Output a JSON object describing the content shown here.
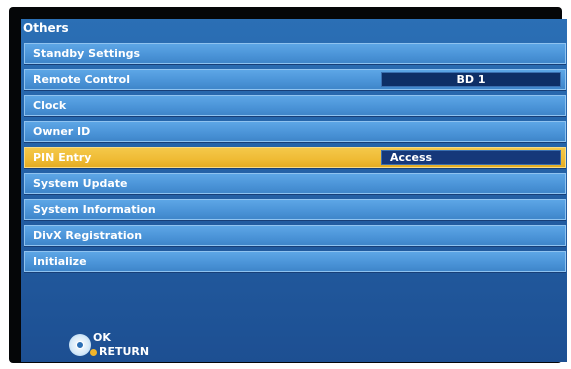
{
  "title": "Others",
  "menu": {
    "items": [
      {
        "label": "Standby Settings"
      },
      {
        "label": "Remote Control",
        "value": "BD 1"
      },
      {
        "label": "Clock"
      },
      {
        "label": "Owner ID"
      },
      {
        "label": "PIN Entry",
        "value": "Access",
        "selected": true
      },
      {
        "label": "System Update"
      },
      {
        "label": "System Information"
      },
      {
        "label": "DivX Registration"
      },
      {
        "label": "Initialize"
      }
    ]
  },
  "footer": {
    "ok_label": "OK",
    "return_label": "RETURN",
    "ok_icon": "dpad-select-icon",
    "return_icon": "return-button-icon"
  },
  "colors": {
    "panel": "#2461a6",
    "row": "#4a93d7",
    "selected_row": "#efbb34",
    "value_box": "#0e2f66"
  }
}
